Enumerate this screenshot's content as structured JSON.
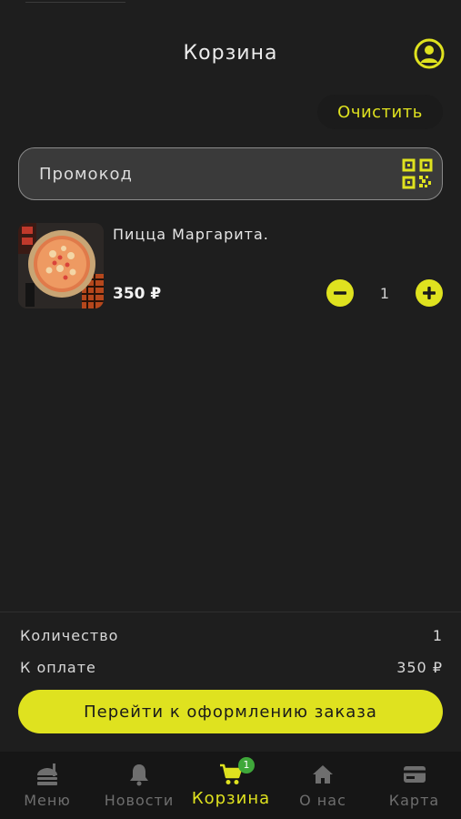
{
  "header": {
    "title": "Корзина",
    "profile_icon": "user-circle-icon"
  },
  "actions": {
    "clear_label": "Очистить"
  },
  "promo": {
    "placeholder": "Промокод",
    "value": "",
    "scan_icon": "qr-code-icon"
  },
  "cart": {
    "items": [
      {
        "name": "Пицца Маргарита.",
        "price": "350 ₽",
        "quantity": "1",
        "image": "pizza-margherita-photo"
      }
    ]
  },
  "summary": {
    "quantity_label": "Количество",
    "quantity_value": "1",
    "total_label": "К оплате",
    "total_value": "350 ₽"
  },
  "checkout": {
    "label": "Перейти к оформлению заказа"
  },
  "tabs": [
    {
      "label": "Меню",
      "icon": "menu-burger-icon",
      "active": false
    },
    {
      "label": "Новости",
      "icon": "bell-icon",
      "active": false
    },
    {
      "label": "Корзина",
      "icon": "cart-icon",
      "active": true,
      "badge": "1"
    },
    {
      "label": "О нас",
      "icon": "home-icon",
      "active": false
    },
    {
      "label": "Карта",
      "icon": "card-icon",
      "active": false
    }
  ],
  "colors": {
    "accent": "#dfe21f",
    "background": "#1e1e1e",
    "badge": "#3fa83a"
  }
}
